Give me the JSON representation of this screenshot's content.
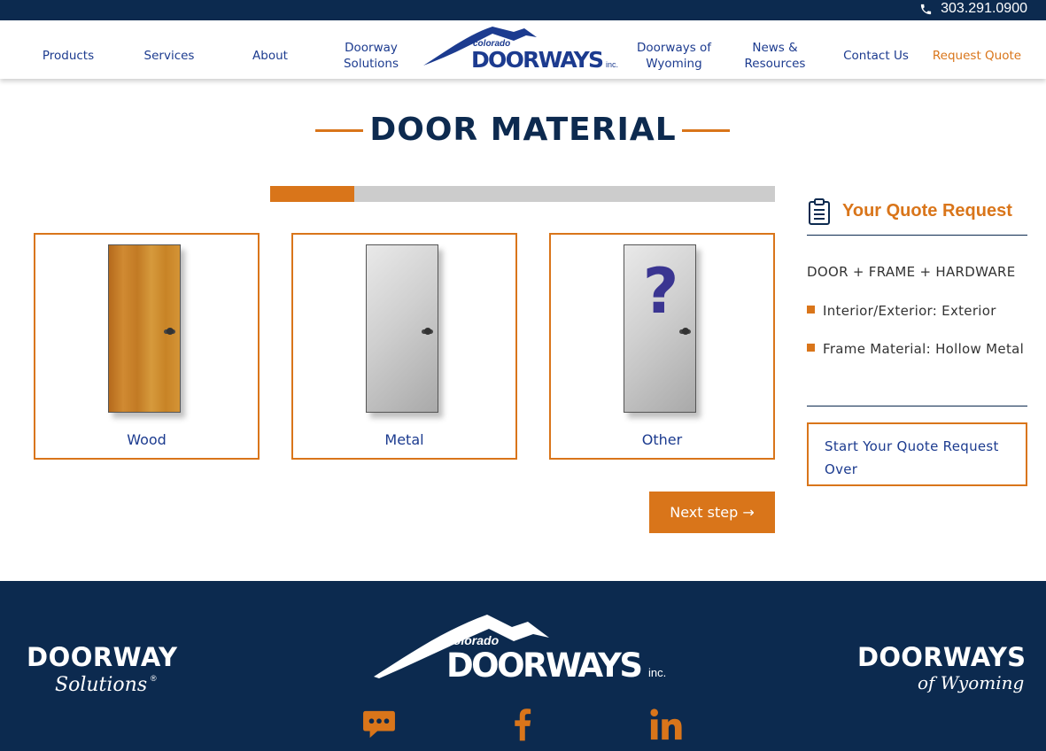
{
  "topbar": {
    "phone": "303.291.0900",
    "phone_icon": "phone-icon"
  },
  "nav": {
    "items": [
      {
        "label": "Products"
      },
      {
        "label": "Services"
      },
      {
        "label": "About"
      },
      {
        "label": "Doorway Solutions"
      },
      {
        "label": "Doorways of Wyoming"
      },
      {
        "label": "News & Resources"
      },
      {
        "label": "Contact Us"
      },
      {
        "label": "Request Quote"
      }
    ],
    "logo": {
      "small": "colorado",
      "main": "DOORWAYS",
      "suffix": "inc."
    }
  },
  "main": {
    "title": "DOOR MATERIAL",
    "progress": 0.167,
    "options": [
      {
        "label": "Wood",
        "kind": "wood"
      },
      {
        "label": "Metal",
        "kind": "metal"
      },
      {
        "label": "Other",
        "kind": "other",
        "mark": "?"
      }
    ],
    "next_label": "Next step →"
  },
  "sidebar": {
    "title": "Your Quote Request",
    "icon": "clipboard-icon",
    "subtitle": "DOOR + FRAME + HARDWARE",
    "items": [
      {
        "label": "Interior/Exterior: Exterior"
      },
      {
        "label": "Frame Material: Hollow Metal"
      }
    ],
    "restart_label": "Start Your Quote Request Over"
  },
  "footer": {
    "left_logo": {
      "main": "DOORWAY",
      "script": "Solutions",
      "mark": "®"
    },
    "center_logo": {
      "small": "colorado",
      "main": "DOORWAYS",
      "suffix": "inc."
    },
    "right_logo": {
      "main": "DOORWAYS",
      "script": "of Wyoming"
    },
    "social": [
      "chat-icon",
      "facebook-icon",
      "linkedin-icon"
    ]
  },
  "colors": {
    "navy": "#0c2a4f",
    "orange": "#d9751a",
    "link_blue": "#1c3b8f"
  }
}
